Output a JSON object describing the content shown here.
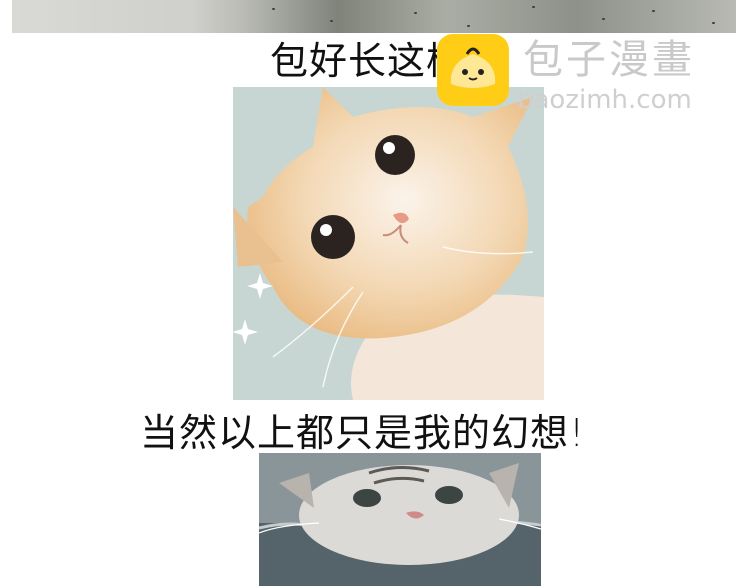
{
  "captions": {
    "top": "包好长这样!",
    "middle": "当然以上都只是我的幻想!"
  },
  "watermark": {
    "brand": "包子漫畫",
    "url": "baozimh.com",
    "logo_icon": "bun-mascot-icon"
  },
  "images": {
    "kitten": "cream-kitten-photo",
    "swimming_cat": "swimming-tabby-cat-photo"
  }
}
